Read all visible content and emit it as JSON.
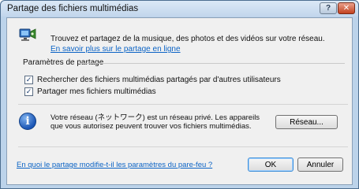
{
  "window": {
    "title": "Partage des fichiers multimédias",
    "help_glyph": "?",
    "close_glyph": "✕"
  },
  "header": {
    "description": "Trouvez et partagez de la musique, des photos et des vidéos sur votre réseau.",
    "learn_more_link": "En savoir plus sur le partage en ligne"
  },
  "sharing_settings": {
    "group_label": "Paramètres de partage",
    "options": [
      {
        "label": "Rechercher des fichiers multimédias partagés par d'autres utilisateurs",
        "checked": true
      },
      {
        "label": "Partager mes fichiers multimédias",
        "checked": true
      }
    ]
  },
  "network_info": {
    "icon_glyph": "i",
    "text": "Votre réseau (ネットワーク) est un réseau privé. Les appareils que vous autorisez peuvent trouver vos fichiers multimédias.",
    "network_button": "Réseau..."
  },
  "footer": {
    "firewall_link": "En quoi le partage modifie-t-il les paramètres du pare-feu ?",
    "ok_button": "OK",
    "cancel_button": "Annuler"
  },
  "colors": {
    "link": "#0b63c5",
    "titlebar": "#c2d6ec",
    "close_button": "#c2411f",
    "info_icon": "#1b56b5"
  },
  "icons": {
    "header": "media-sharing-icon",
    "info": "info-icon"
  }
}
